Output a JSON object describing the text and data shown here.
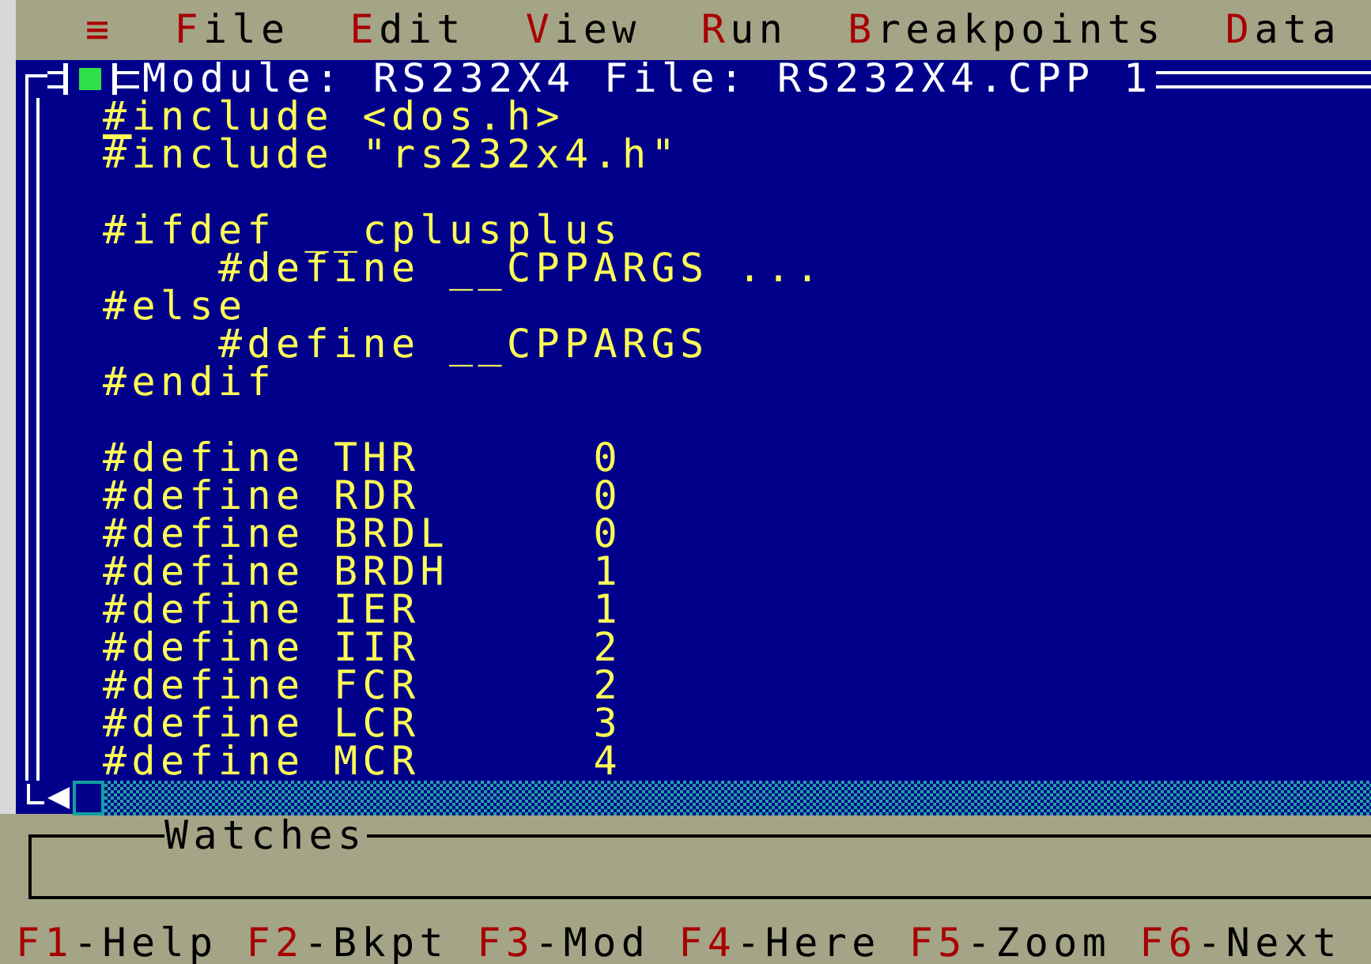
{
  "menu": [
    {
      "hotkey": "≡"
    },
    {
      "hotkey": "F",
      "label": "ile"
    },
    {
      "hotkey": "E",
      "label": "dit"
    },
    {
      "hotkey": "V",
      "label": "iew"
    },
    {
      "hotkey": "R",
      "label": "un"
    },
    {
      "hotkey": "B",
      "label": "reakpoints"
    },
    {
      "hotkey": "D",
      "label": "ata"
    }
  ],
  "editor": {
    "title": "Module: RS232X4 File: RS232X4.CPP 1",
    "lines": [
      {
        "kind": "code",
        "text": "#include <dos.h>",
        "cursor": true
      },
      {
        "kind": "code",
        "text": "#include \"rs232x4.h\"",
        "cursor": false
      },
      {
        "kind": "blank"
      },
      {
        "kind": "code",
        "text": "#ifdef __cplusplus",
        "cursor": false
      },
      {
        "kind": "code",
        "text": "    #define __CPPARGS ...",
        "cursor": false
      },
      {
        "kind": "code",
        "text": "#else",
        "cursor": false
      },
      {
        "kind": "code",
        "text": "    #define __CPPARGS",
        "cursor": false
      },
      {
        "kind": "code",
        "text": "#endif",
        "cursor": false
      },
      {
        "kind": "blank"
      },
      {
        "kind": "code",
        "text": "#define THR      0",
        "cursor": false
      },
      {
        "kind": "code",
        "text": "#define RDR      0",
        "cursor": false
      },
      {
        "kind": "code",
        "text": "#define BRDL     0",
        "cursor": false
      },
      {
        "kind": "code",
        "text": "#define BRDH     1",
        "cursor": false
      },
      {
        "kind": "code",
        "text": "#define IER      1",
        "cursor": false
      },
      {
        "kind": "code",
        "text": "#define IIR      2",
        "cursor": false
      },
      {
        "kind": "code",
        "text": "#define FCR      2",
        "cursor": false
      },
      {
        "kind": "code",
        "text": "#define LCR      3",
        "cursor": false
      },
      {
        "kind": "code",
        "text": "#define MCR      4",
        "cursor": false
      }
    ]
  },
  "watches": {
    "title": "Watches"
  },
  "status_bar": [
    {
      "key": "F1",
      "label": "-Help"
    },
    {
      "key": "F2",
      "label": "-Bkpt"
    },
    {
      "key": "F3",
      "label": "-Mod"
    },
    {
      "key": "F4",
      "label": "-Here"
    },
    {
      "key": "F5",
      "label": "-Zoom"
    },
    {
      "key": "F6",
      "label": "-Next"
    }
  ]
}
